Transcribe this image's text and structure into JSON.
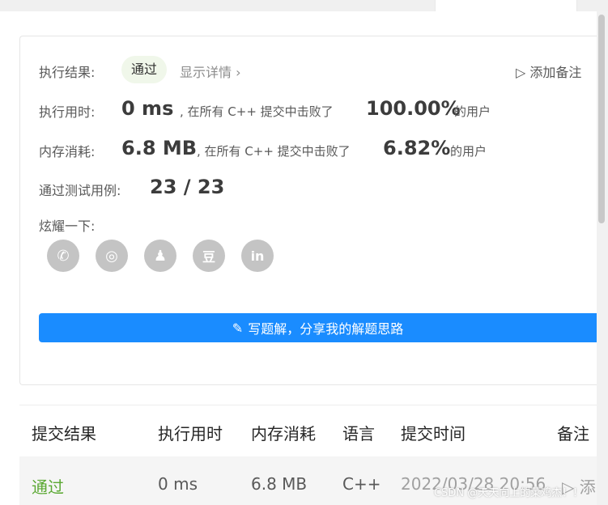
{
  "result": {
    "label": "执行结果:",
    "status": "通过",
    "details_link": "显示详情",
    "details_chevron": "›",
    "add_note": "添加备注",
    "flag_glyph": "▷"
  },
  "runtime": {
    "label": "执行用时:",
    "value": "0 ms",
    "mid_text": ", 在所有 C++ 提交中击败了",
    "percent": "100.00%",
    "suffix": "的用户"
  },
  "memory": {
    "label": "内存消耗:",
    "value": "6.8 MB",
    "mid_text": ", 在所有 C++ 提交中击败了",
    "percent": "6.82%",
    "suffix": "的用户"
  },
  "tests": {
    "label": "通过测试用例:",
    "value": "23 / 23"
  },
  "share": {
    "label": "炫耀一下:",
    "icons": [
      {
        "name": "wechat-icon",
        "glyph": "✆"
      },
      {
        "name": "weibo-icon",
        "glyph": "◎"
      },
      {
        "name": "qq-icon",
        "glyph": "♟"
      },
      {
        "name": "douban-icon",
        "glyph": "豆"
      },
      {
        "name": "linkedin-icon",
        "glyph": "in"
      }
    ]
  },
  "write_solution": {
    "label": "写题解，分享我的解题思路",
    "icon": "✎"
  },
  "table": {
    "headers": [
      "提交结果",
      "执行用时",
      "内存消耗",
      "语言",
      "提交时间",
      "备注"
    ],
    "rows": [
      {
        "status": "通过",
        "runtime": "0 ms",
        "memory": "6.8 MB",
        "language": "C++",
        "time": "2022/03/28 20:56",
        "note": "▷ 添"
      }
    ]
  },
  "colors": {
    "accent": "#1a8cff",
    "success": "#5aa832",
    "badge_bg": "#f0f7ea"
  },
  "watermark": "CSDN @天天向上的菜鸡杰！！"
}
